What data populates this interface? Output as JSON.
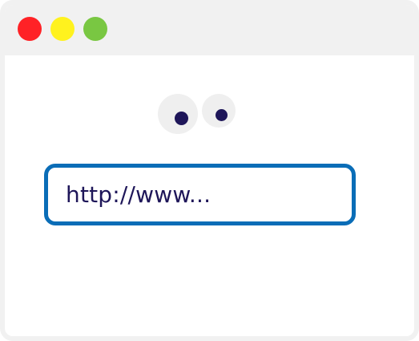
{
  "window": {
    "controls": [
      {
        "name": "close",
        "color": "#ff2226"
      },
      {
        "name": "minimize",
        "color": "#fff21e"
      },
      {
        "name": "maximize",
        "color": "#79c742"
      }
    ]
  },
  "mascot": {
    "pupil_color": "#1e1659"
  },
  "address_bar": {
    "value": "http://www...",
    "text_color": "#1e1659",
    "border_color": "#0a6db7"
  }
}
